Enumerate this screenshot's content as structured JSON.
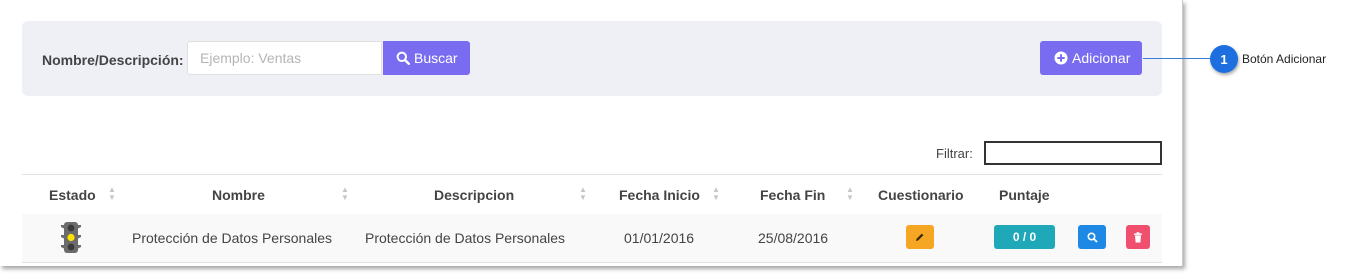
{
  "search": {
    "label": "Nombre/Descripción:",
    "placeholder": "Ejemplo: Ventas",
    "search_button": "Buscar",
    "add_button": "Adicionar"
  },
  "filter": {
    "label": "Filtrar:",
    "value": ""
  },
  "table": {
    "headers": [
      "Estado",
      "Nombre",
      "Descripcion",
      "Fecha Inicio",
      "Fecha Fin",
      "Cuestionario",
      "Puntaje"
    ],
    "rows": [
      {
        "estado_icon": "traffic-light-icon",
        "nombre": "Protección de Datos Personales",
        "descripcion": "Protección de Datos Personales",
        "fecha_inicio": "01/01/2016",
        "fecha_fin": "25/08/2016",
        "puntaje": "0 / 0"
      }
    ]
  },
  "callout": {
    "number": "1",
    "text": "Botón Adicionar"
  },
  "colors": {
    "primary": "#7a6cf0",
    "edit": "#f5a623",
    "score": "#1fa8b8",
    "view": "#1e88e5",
    "delete": "#f0506e",
    "callout": "#1d6fe0"
  }
}
